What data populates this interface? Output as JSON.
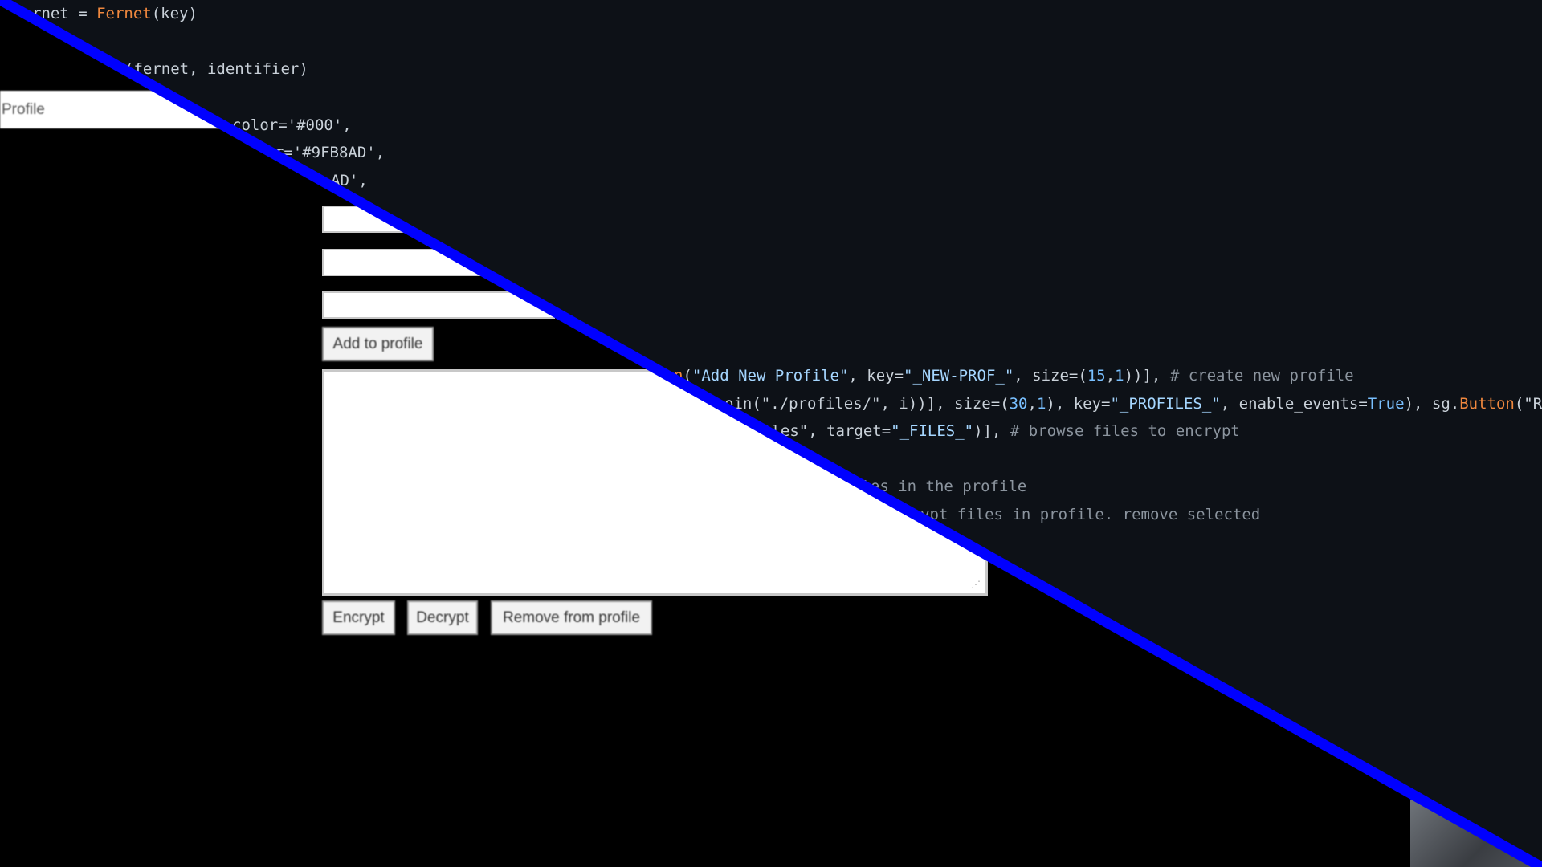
{
  "editor": {
    "lines": [
      {
        "segments": [
          {
            "t": "rnet = "
          },
          {
            "t": "Fernet",
            "c": "fn"
          },
          {
            "t": "(key)"
          }
        ]
      },
      {
        "segments": [
          {
            "t": "(fernet, identifier)"
          }
        ]
      },
      {
        "segments": [
          {
            "t": "color='#000',"
          }
        ]
      },
      {
        "segments": [
          {
            "t": "lor='#9FB8AD',"
          }
        ]
      },
      {
        "segments": [
          {
            "t": "AD',"
          }
        ]
      },
      {
        "segments": [
          {
            "t": "n",
            "c": "fn"
          },
          {
            "t": "("
          },
          {
            "t": "\"Add New Profile\"",
            "c": "str"
          },
          {
            "t": ", key="
          },
          {
            "t": "\"_NEW-PROF_\"",
            "c": "str"
          },
          {
            "t": ", size=("
          },
          {
            "t": "15",
            "c": "num"
          },
          {
            "t": ","
          },
          {
            "t": "1",
            "c": "num"
          },
          {
            "t": "))], "
          },
          {
            "t": "# create new profile",
            "c": "cm"
          }
        ]
      },
      {
        "segments": [
          {
            "t": "oin(\"./profiles/\", i))], size=("
          },
          {
            "t": "30",
            "c": "num"
          },
          {
            "t": ","
          },
          {
            "t": "1",
            "c": "num"
          },
          {
            "t": "), key="
          },
          {
            "t": "\"_PROFILES_\"",
            "c": "str"
          },
          {
            "t": ", enable_events="
          },
          {
            "t": "True",
            "c": "kw"
          },
          {
            "t": "), sg."
          },
          {
            "t": "Button",
            "c": "fn"
          },
          {
            "t": "(\"R"
          }
        ]
      },
      {
        "segments": [
          {
            "t": "iles\", target="
          },
          {
            "t": "\"_FILES_\"",
            "c": "str"
          },
          {
            "t": ")], "
          },
          {
            "t": "# browse files to encrypt",
            "c": "cm"
          }
        ]
      },
      {
        "segments": [
          {
            "t": "iles in the profile",
            "c": "cm"
          }
        ]
      },
      {
        "segments": [
          {
            "t": "ypt files in profile. remove selected",
            "c": "cm"
          }
        ]
      }
    ]
  },
  "app": {
    "profile_combo": {
      "value": "Profile"
    },
    "fields": [
      {
        "name": "input-1",
        "value": ""
      },
      {
        "name": "input-2",
        "value": ""
      },
      {
        "name": "input-3",
        "value": ""
      }
    ],
    "add_to_profile_label": "Add to profile",
    "file_list": [],
    "encrypt_label": "Encrypt",
    "decrypt_label": "Decrypt",
    "remove_label": "Remove from profile",
    "resize_grip_icon": "resize-grip-icon"
  },
  "colors": {
    "editor_bg": "#0d1117",
    "divider": "#0000ff",
    "function": "#f0883e",
    "string": "#a5d6ff",
    "number": "#79c0ff",
    "comment": "#8b949e"
  }
}
